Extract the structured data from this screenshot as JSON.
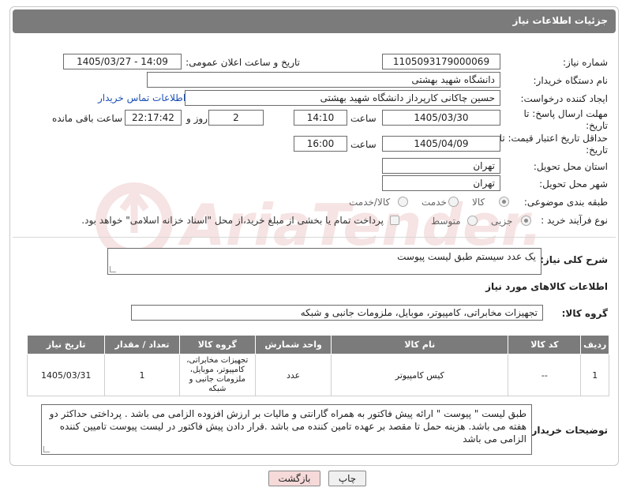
{
  "header": {
    "title": "جزئیات اطلاعات نیاز"
  },
  "fields": {
    "need_number_label": "شماره نیاز:",
    "need_number": "1105093179000069",
    "announce_label": "تاریخ و ساعت اعلان عمومی:",
    "announce_value": "1405/03/27 - 14:09",
    "buyer_org_label": "نام دستگاه خریدار:",
    "buyer_org": "دانشگاه شهید بهشتی",
    "creator_label": "ایجاد کننده درخواست:",
    "creator": "حسین چاکانی کارپرداز دانشگاه شهید بهشتی",
    "contact_link": "اطلاعات تماس خریدار",
    "reply_deadline_label": "مهلت ارسال پاسخ: تا تاریخ:",
    "reply_date": "1405/03/30",
    "hour_label": "ساعت",
    "reply_time": "14:10",
    "days": "2",
    "days_label": "روز و",
    "remaining_time": "22:17:42",
    "remaining_label": "ساعت باقی مانده",
    "price_validity_label": "حداقل تاریخ اعتبار قیمت: تا تاریخ:",
    "price_date": "1405/04/09",
    "price_hour_label": "ساعت",
    "price_time": "16:00",
    "province_label": "استان محل تحویل:",
    "province": "تهران",
    "city_label": "شهر محل تحویل:",
    "city": "تهران",
    "category_label": "طبقه بندی موضوعی:",
    "category_options": [
      "کالا",
      "خدمت",
      "کالا/خدمت"
    ],
    "purchase_type_label": "نوع فرآیند خرید :",
    "purchase_options": [
      "جزیی",
      "متوسط"
    ],
    "payment_note": "پرداخت تمام یا بخشی از مبلغ خرید،از محل \"اسناد خزانه اسلامی\" خواهد بود."
  },
  "description": {
    "label": "شرح کلی نیاز:",
    "value": "یک عدد سیستم طبق لیست پیوست"
  },
  "goods": {
    "section_title": "اطلاعات کالاهای مورد نیاز",
    "group_label": "گروه کالا:",
    "group_value": "تجهیزات مخابراتی، کامپیوتر، موبایل، ملزومات جانبی و شبکه",
    "columns": [
      "ردیف",
      "کد کالا",
      "نام کالا",
      "واحد شمارش",
      "گروه کالا",
      "تعداد / مقدار",
      "تاریخ نیاز"
    ],
    "rows": [
      {
        "row": "1",
        "code": "--",
        "name": "کیس کامپیوتر",
        "unit": "عدد",
        "group": "تجهیزات مخابراتی، کامپیوتر، موبایل، ملزومات جانبی و شبکه",
        "qty": "1",
        "date": "1405/03/31"
      }
    ]
  },
  "buyer_notes": {
    "label": "توضیحات خریدار:",
    "value": "طبق لیست \" پیوست \"  ارائه پیش فاکتور به همراه گارانتی و مالیات بر ارزش افزوده الزامی می باشد . پرداختی حداکثر دو هفته  می باشد. هزینه حمل تا مقصد بر عهده تامین کننده می باشد .قرار دادن پیش فاکتور در لیست پیوست تامیین کننده الزامی می باشد"
  },
  "buttons": {
    "print": "چاپ",
    "back": "بازگشت"
  },
  "watermark": {
    "text": "AriaTender.net"
  },
  "colors": {
    "header_bg": "#7b7b7b",
    "link": "#1a4fb4",
    "back_button_bg": "#f6d9d9",
    "watermark": "#c03030"
  }
}
